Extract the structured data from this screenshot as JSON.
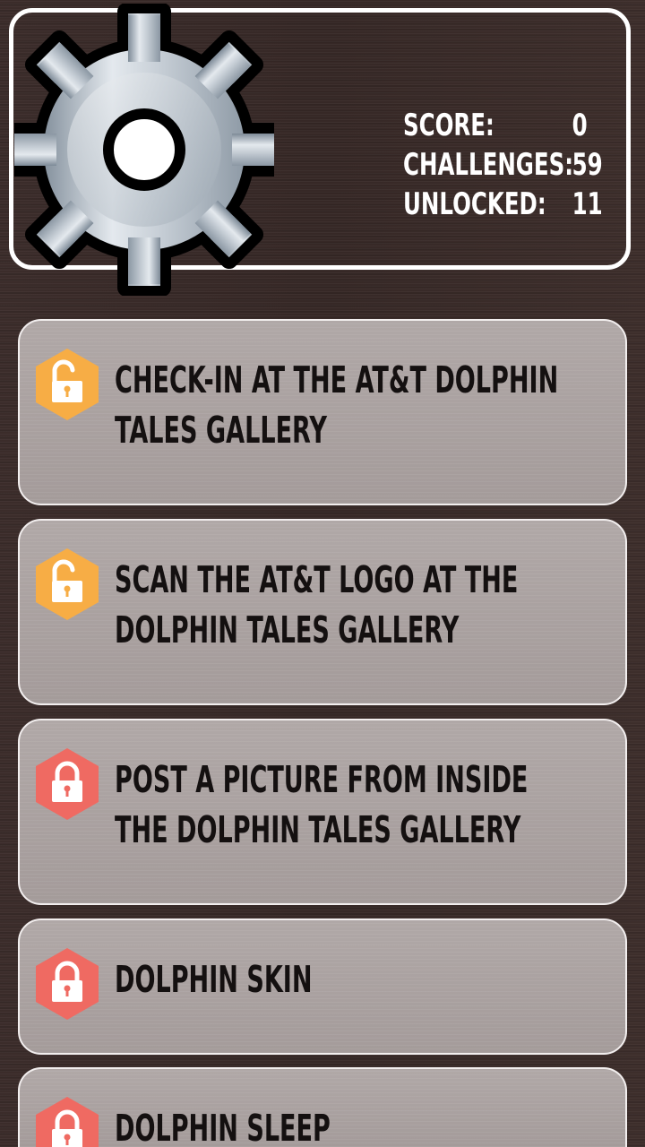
{
  "header": {
    "stats": [
      {
        "label": "SCORE:",
        "value": "0"
      },
      {
        "label": "CHALLENGES:",
        "value": "59"
      },
      {
        "label": "UNLOCKED:",
        "value": "11"
      }
    ]
  },
  "challenges": [
    {
      "title": "CHECK-IN AT THE AT&T DOLPHIN TALES GALLERY",
      "status": "unlocked"
    },
    {
      "title": "SCAN THE AT&T LOGO AT THE DOLPHIN TALES GALLERY",
      "status": "unlocked"
    },
    {
      "title": "POST A PICTURE FROM INSIDE THE DOLPHIN TALES GALLERY",
      "status": "locked"
    },
    {
      "title": "DOLPHIN SKIN",
      "status": "locked"
    },
    {
      "title": "DOLPHIN SLEEP",
      "status": "locked"
    }
  ],
  "colors": {
    "unlocked_badge": "#f7ad45",
    "locked_badge": "#ef6a62",
    "background": "#3a2b29",
    "card": "#aaa1a0"
  },
  "icons": {
    "settings": "gear-icon",
    "unlocked": "unlocked-padlock-icon",
    "locked": "locked-padlock-icon"
  }
}
